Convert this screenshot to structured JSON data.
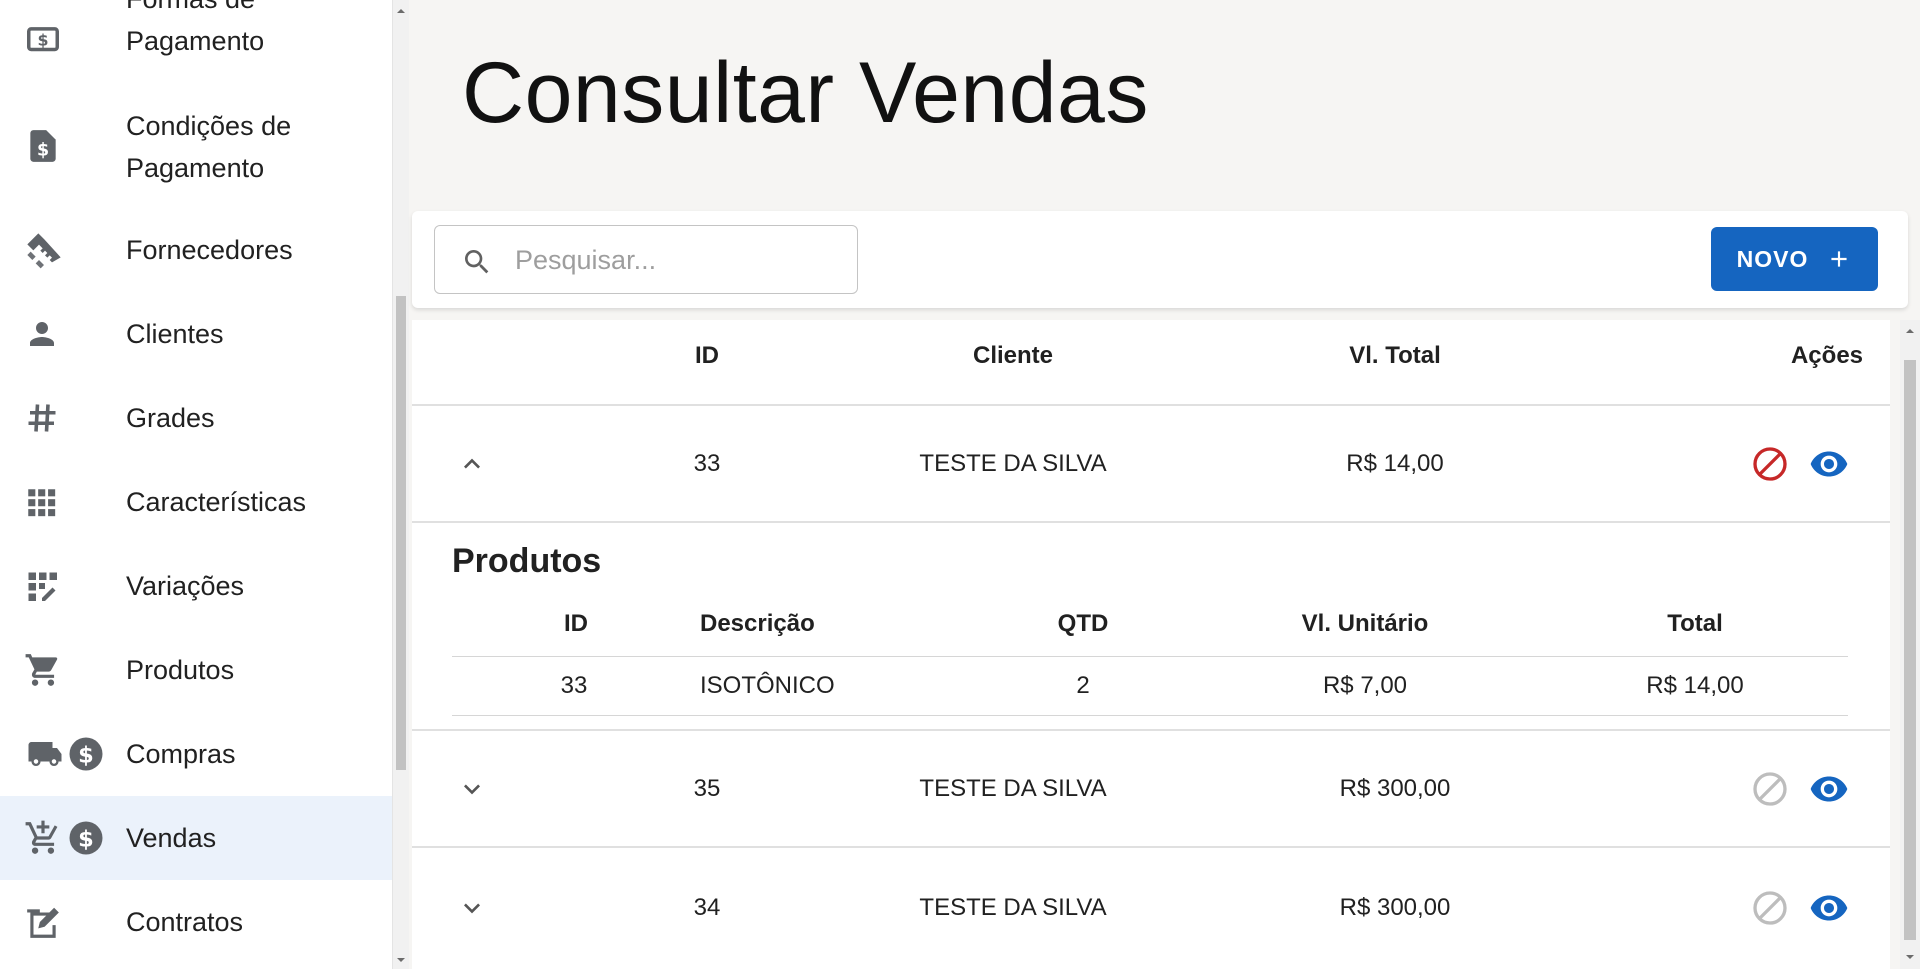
{
  "sidebar": {
    "items": [
      {
        "label_line1": "Formas de",
        "label_line2": "Pagamento",
        "icon": "dollar-box-icon"
      },
      {
        "label_line1": "Condições de",
        "label_line2": "Pagamento",
        "icon": "dollar-file-icon"
      },
      {
        "label": "Fornecedores",
        "icon": "handshake-icon"
      },
      {
        "label": "Clientes",
        "icon": "person-icon"
      },
      {
        "label": "Grades",
        "icon": "hash-icon"
      },
      {
        "label": "Características",
        "icon": "grid-icon"
      },
      {
        "label": "Variações",
        "icon": "grid-edit-icon"
      },
      {
        "label": "Produtos",
        "icon": "cart-icon"
      },
      {
        "label": "Compras",
        "icon": "truck-dollar-icon"
      },
      {
        "label": "Vendas",
        "icon": "cart-add-dollar-icon",
        "active": true
      },
      {
        "label": "Contratos",
        "icon": "contract-icon"
      }
    ]
  },
  "page": {
    "title": "Consultar Vendas"
  },
  "search": {
    "placeholder": "Pesquisar..."
  },
  "toolbar": {
    "new_label": "NOVO"
  },
  "table": {
    "headers": {
      "id": "ID",
      "cliente": "Cliente",
      "total": "Vl. Total",
      "acoes": "Ações"
    },
    "rows": [
      {
        "id": "33",
        "cliente": "TESTE DA SILVA",
        "total": "R$ 14,00",
        "expanded": true,
        "cancel_enabled": true
      },
      {
        "id": "35",
        "cliente": "TESTE DA SILVA",
        "total": "R$ 300,00",
        "expanded": false,
        "cancel_enabled": false
      },
      {
        "id": "34",
        "cliente": "TESTE DA SILVA",
        "total": "R$ 300,00",
        "expanded": false,
        "cancel_enabled": false
      }
    ]
  },
  "products": {
    "title": "Produtos",
    "headers": {
      "id": "ID",
      "descricao": "Descrição",
      "qtd": "QTD",
      "unitario": "Vl. Unitário",
      "total": "Total"
    },
    "rows": [
      {
        "id": "33",
        "descricao": "ISOTÔNICO",
        "qtd": "2",
        "unitario": "R$ 7,00",
        "total": "R$ 14,00"
      }
    ]
  },
  "colors": {
    "primary": "#1565c0",
    "cancel_active": "#c62828",
    "cancel_disabled": "#bdbdbd",
    "sidebar_active_bg": "#ebf2fb"
  }
}
